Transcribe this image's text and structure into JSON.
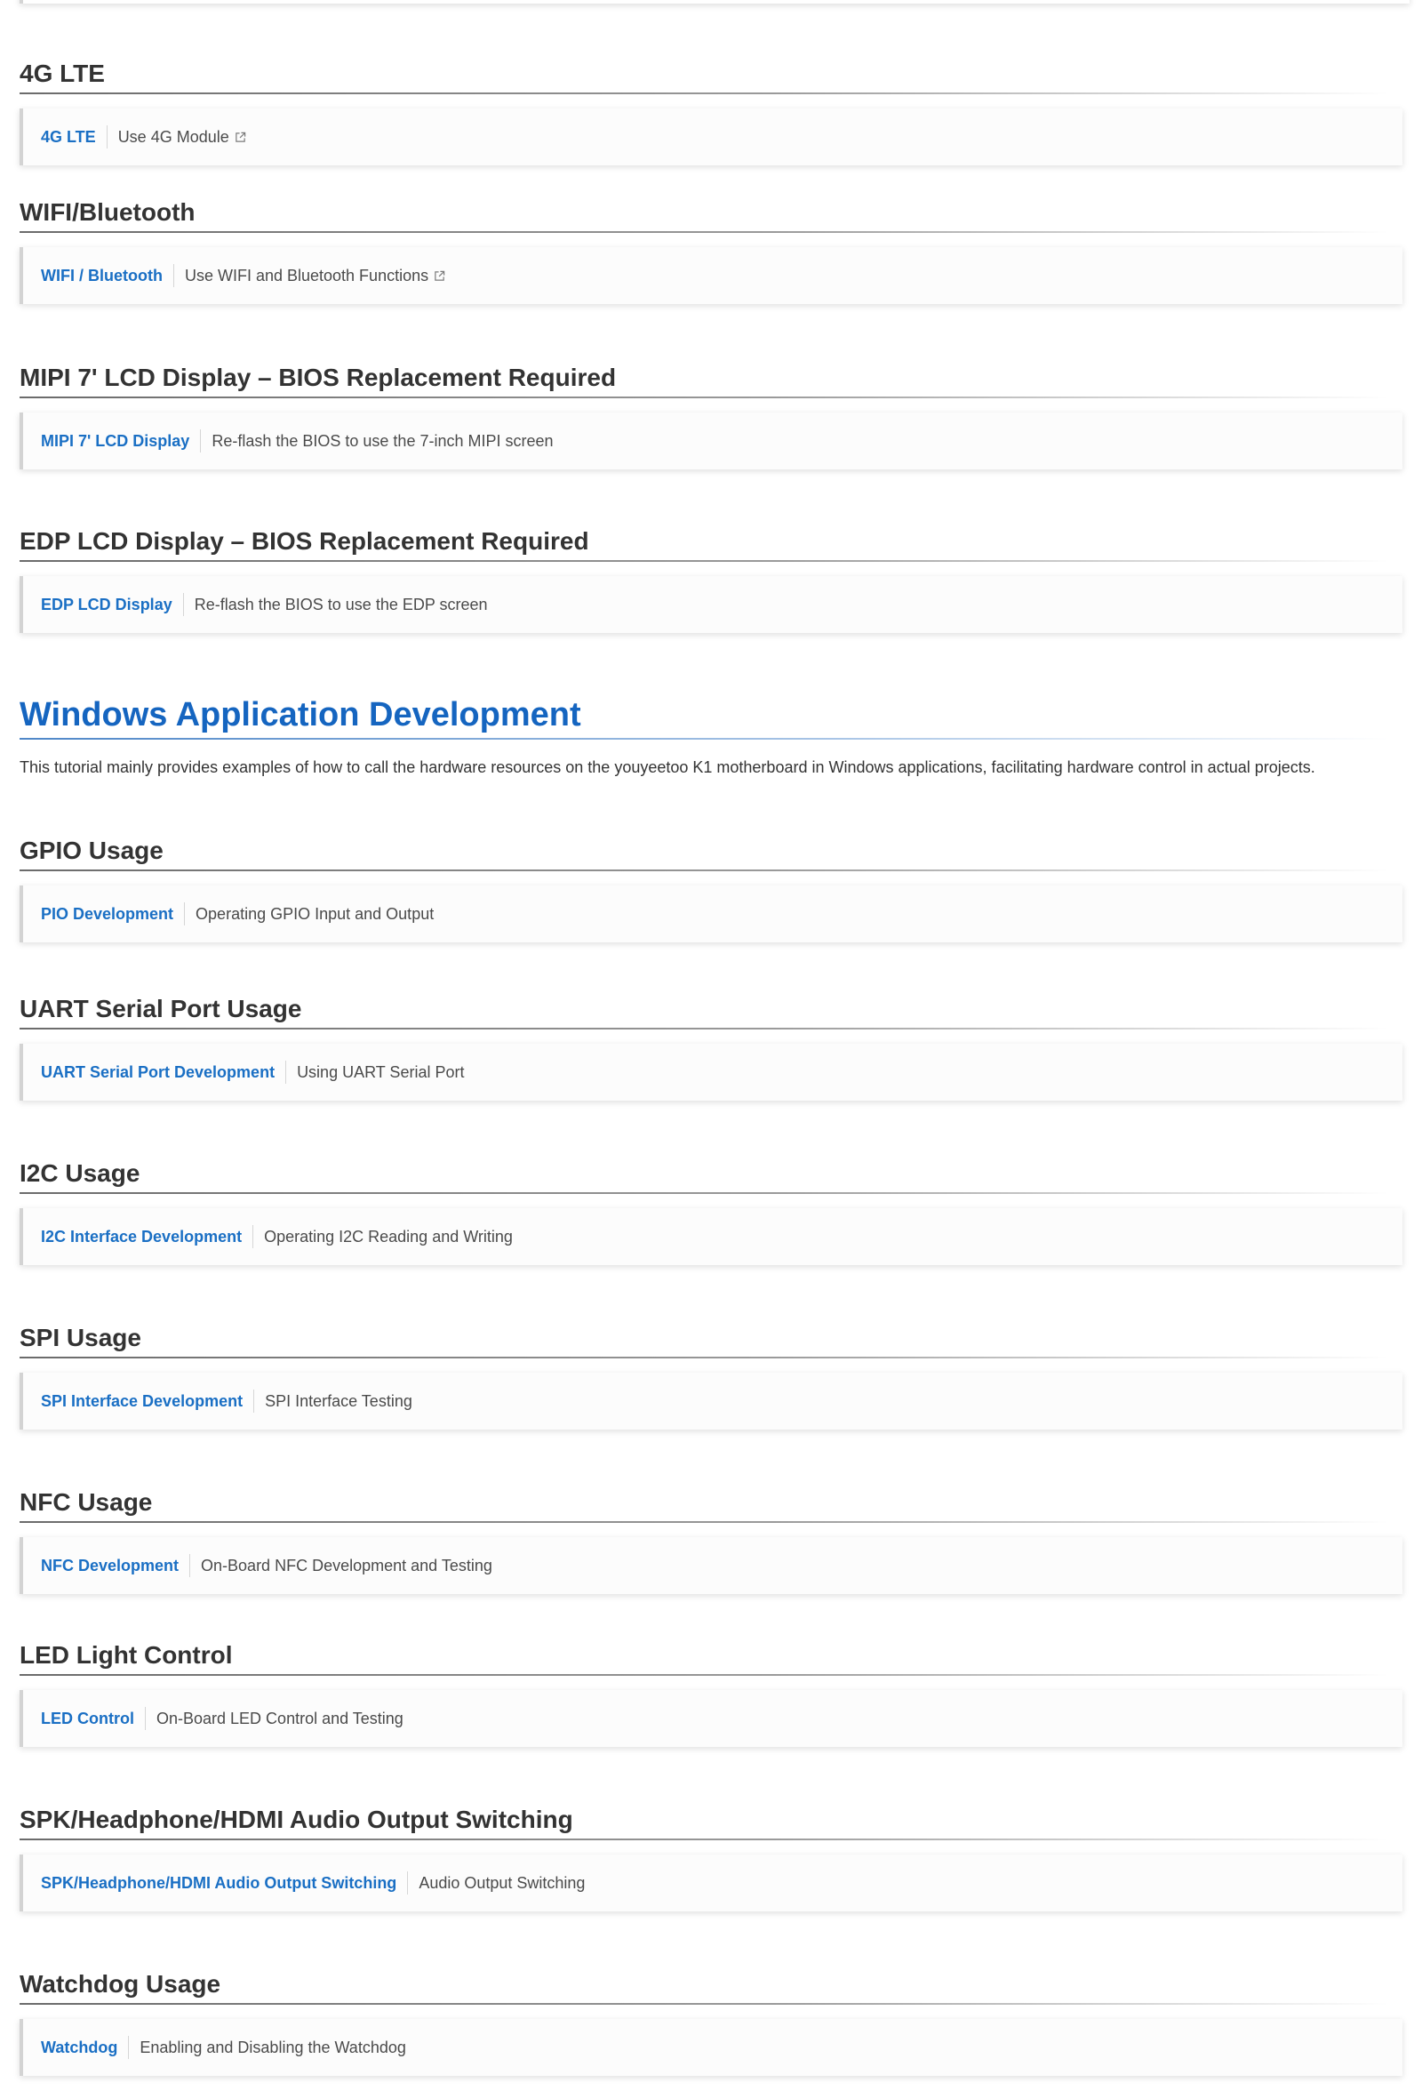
{
  "sections_top": [
    {
      "heading": "4G LTE",
      "link": "4G LTE",
      "desc": "Use 4G Module",
      "external": true
    },
    {
      "heading": "WIFI/Bluetooth",
      "link": "WIFI / Bluetooth",
      "desc": "Use WIFI and Bluetooth Functions",
      "external": true
    },
    {
      "heading": "MIPI 7' LCD Display – BIOS Replacement Required",
      "link": "MIPI 7' LCD Display",
      "desc": "Re-flash the BIOS to use the 7-inch MIPI screen",
      "external": false
    },
    {
      "heading": "EDP LCD Display – BIOS Replacement Required",
      "link": "EDP LCD Display",
      "desc": "Re-flash the BIOS to use the EDP screen",
      "external": false
    }
  ],
  "windows": {
    "title": "Windows Application Development",
    "intro": "This tutorial mainly provides examples of how to call the hardware resources on the youyeetoo K1 motherboard in Windows applications, facilitating hardware control in actual projects."
  },
  "sections_bottom": [
    {
      "heading": "GPIO Usage",
      "link": "PIO Development",
      "desc": "Operating GPIO Input and Output"
    },
    {
      "heading": "UART Serial Port Usage",
      "link": "UART Serial Port Development",
      "desc": "Using UART Serial Port"
    },
    {
      "heading": "I2C Usage",
      "link": "I2C Interface Development",
      "desc": "Operating I2C Reading and Writing"
    },
    {
      "heading": "SPI Usage",
      "link": "SPI Interface Development",
      "desc": "SPI Interface Testing"
    },
    {
      "heading": "NFC Usage",
      "link": "NFC Development",
      "desc": "On-Board NFC Development and Testing"
    },
    {
      "heading": "LED Light Control",
      "link": "LED Control",
      "desc": "On-Board LED Control and Testing"
    },
    {
      "heading": "SPK/Headphone/HDMI Audio Output Switching",
      "link": "SPK/Headphone/HDMI Audio Output Switching",
      "desc": "Audio Output Switching"
    },
    {
      "heading": "Watchdog Usage",
      "link": "Watchdog",
      "desc": "Enabling and Disabling the Watchdog"
    }
  ],
  "icons": {
    "external": "external-link-icon"
  },
  "colors": {
    "link": "#1a6fc4",
    "heading_blue": "#1565c0",
    "text": "#333333"
  }
}
